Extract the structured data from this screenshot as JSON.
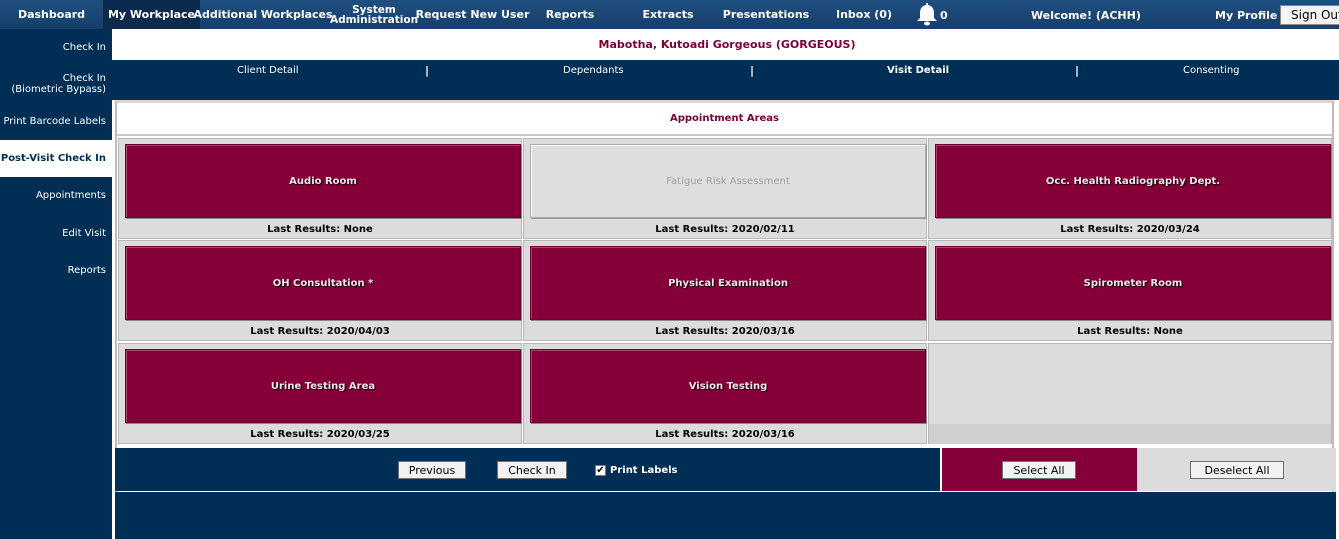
{
  "nav": {
    "items": [
      {
        "label": "Dashboard"
      },
      {
        "label": "My Workplace"
      },
      {
        "label": "Additional Workplaces"
      },
      {
        "label": "System Administration"
      },
      {
        "label": "Request New User"
      },
      {
        "label": "Reports"
      },
      {
        "label": "Extracts"
      },
      {
        "label": "Presentations"
      },
      {
        "label": "Inbox (0)"
      }
    ],
    "notification_count": "0",
    "welcome": "Welcome! (ACHH)",
    "my_profile": "My Profile",
    "sign_out": "Sign Out"
  },
  "sidebar": {
    "items": [
      {
        "label": "Check In"
      },
      {
        "label": "Check In (Biometric Bypass)"
      },
      {
        "label": "Print Barcode Labels"
      },
      {
        "label": "Post-Visit Check In"
      },
      {
        "label": "Appointments"
      },
      {
        "label": "Edit Visit"
      },
      {
        "label": "Reports"
      }
    ]
  },
  "client": {
    "name": "Mabotha, Kutoadi Gorgeous (GORGEOUS)"
  },
  "subnav": {
    "tabs": [
      {
        "label": "Client Detail"
      },
      {
        "label": "Dependants"
      },
      {
        "label": "Visit Detail"
      },
      {
        "label": "Consenting"
      }
    ],
    "separator": "|"
  },
  "appointments": {
    "title": "Appointment Areas",
    "areas": [
      {
        "name": "Audio Room",
        "last_results": "Last Results: None"
      },
      {
        "name": "Fatigue Risk Assessment",
        "last_results": "Last Results: 2020/02/11"
      },
      {
        "name": "Occ. Health Radiography Dept.",
        "last_results": "Last Results: 2020/03/24"
      },
      {
        "name": "OH Consultation *",
        "last_results": "Last Results: 2020/04/03"
      },
      {
        "name": "Physical Examination",
        "last_results": "Last Results: 2020/03/16"
      },
      {
        "name": "Spirometer Room",
        "last_results": "Last Results: None"
      },
      {
        "name": "Urine Testing Area",
        "last_results": "Last Results: 2020/03/25"
      },
      {
        "name": "Vision Testing",
        "last_results": "Last Results: 2020/03/16"
      }
    ]
  },
  "actions": {
    "previous": "Previous",
    "check_in": "Check In",
    "print_labels": "Print Labels",
    "select_all": "Select All",
    "deselect_all": "Deselect All"
  },
  "colors": {
    "navy": "#002e55",
    "maroon": "#850038"
  }
}
